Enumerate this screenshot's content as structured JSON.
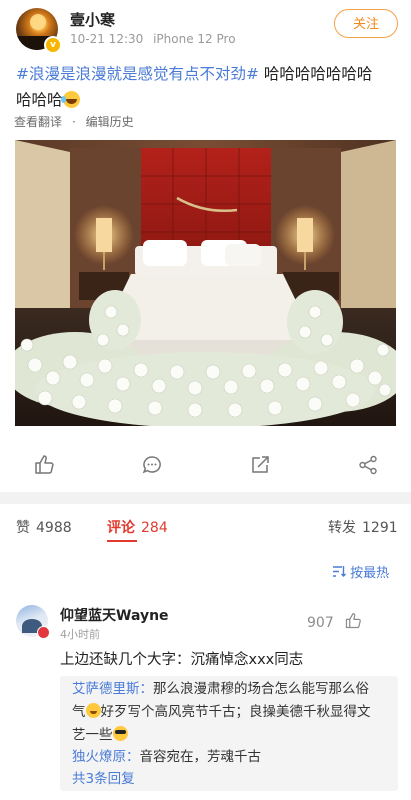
{
  "post": {
    "author": "壹小寒",
    "date": "10-21 12:30",
    "device": "iPhone 12 Pro",
    "follow_label": "关注",
    "hashtag": "#浪漫是浪漫就是感觉有点不对劲#",
    "text_line1_rest": " 哈哈哈哈哈哈哈",
    "text_line2": "哈哈哈",
    "text_emoji": "laughing-tears-emoji",
    "translate_label": "查看翻译",
    "history_label": "编辑历史",
    "image_semantic": "hotel bed surrounded by white roses and baby's breath"
  },
  "actions": [
    "like-icon",
    "comment-icon",
    "share-icon",
    "more-share-icon"
  ],
  "stats": {
    "likes_label": "赞",
    "likes_count": "4988",
    "comments_label": "评论",
    "comments_count": "284",
    "reposts_label": "转发",
    "reposts_count": "1291"
  },
  "sort": {
    "icon": "sort-icon",
    "label": "按最热"
  },
  "comment": {
    "author": "仰望蓝天Wayne",
    "time": "4小时前",
    "likes": "907",
    "text": "上边还缺几个大字：沉痛悼念xxx同志",
    "replies": {
      "r1_name": "艾萨德里斯：",
      "r1_line1": "那么浪漫肃穆的场合怎么能写那么俗",
      "r1_line2a": "气",
      "r1_line2b": "好歹写个高风亮节千古；良操美德千秋显得文",
      "r1_line3": "艺一些",
      "r2_name": "独火燎原：",
      "r2_text": "音容宛在，芳魂千古",
      "more_label": "共3条回复"
    }
  },
  "colors": {
    "accent_blue": "#4a7bd6",
    "accent_red": "#e03a2f",
    "follow_orange": "#f08a1c"
  }
}
